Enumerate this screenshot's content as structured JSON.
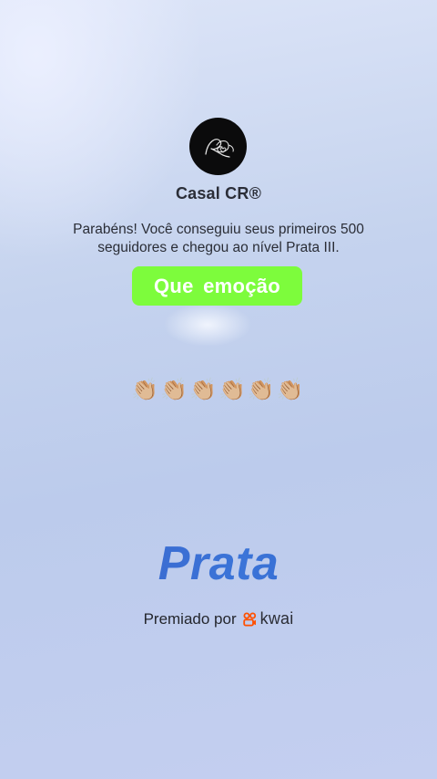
{
  "profile": {
    "name": "Casal CR®",
    "avatar_icon": "couple-monogram-logo"
  },
  "message": {
    "line1": "Parabéns! Você conseguiu seus primeiros 500",
    "line2": "seguidores e chegou ao nível Prata III."
  },
  "highlight": {
    "text": "Que emoção",
    "color": "#7dfc3c"
  },
  "claps": {
    "emoji": "👏🏼👏🏼👏🏼👏🏼👏🏼👏🏼"
  },
  "tier": {
    "name": "Prata",
    "color": "#3a67cf"
  },
  "awarded": {
    "label": "Premiado por",
    "brand": "kwai",
    "brand_icon": "kwai-logo-icon",
    "brand_color": "#ff5000"
  }
}
